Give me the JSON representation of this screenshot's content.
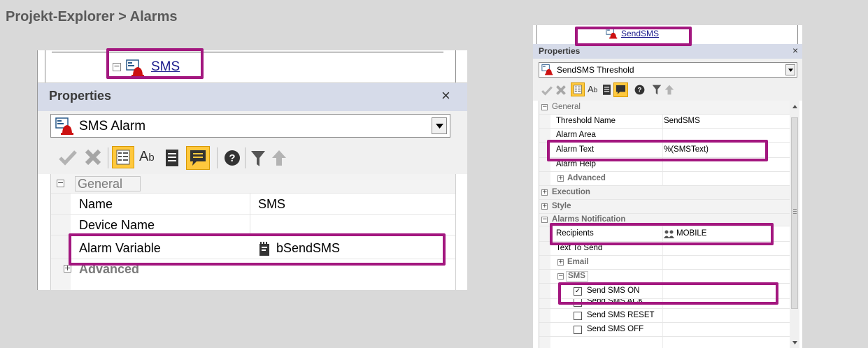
{
  "page_title": "Projekt-Explorer > Alarms",
  "left": {
    "tree_item_label": "SMS",
    "panel_title": "Properties",
    "selector_value": "SMS Alarm",
    "group_general": "General",
    "group_advanced": "Advanced",
    "properties": [
      {
        "name": "Name",
        "value": "SMS"
      },
      {
        "name": "Device Name",
        "value": ""
      },
      {
        "name": "Alarm Variable",
        "value": "bSendSMS"
      }
    ]
  },
  "right": {
    "tree_item_label": "SendSMS",
    "panel_title": "Properties",
    "selector_value": "SendSMS Threshold",
    "groups": {
      "general": "General",
      "advanced": "Advanced",
      "execution": "Execution",
      "style": "Style",
      "alarms_notification": "Alarms Notification",
      "email": "Email",
      "sms": "SMS"
    },
    "properties": {
      "threshold_name": {
        "name": "Threshold Name",
        "value": "SendSMS"
      },
      "alarm_area": {
        "name": "Alarm Area",
        "value": ""
      },
      "alarm_text": {
        "name": "Alarm Text",
        "value": "%(SMSText)"
      },
      "alarm_help": {
        "name": "Alarm Help",
        "value": ""
      },
      "recipients": {
        "name": "Recipients",
        "value": "MOBILE"
      },
      "text_to_send": {
        "name": "Text To Send",
        "value": ""
      }
    },
    "sms_options": [
      {
        "label": "Send SMS ON",
        "checked": true
      },
      {
        "label": "Send SMS ACK",
        "checked": false
      },
      {
        "label": "Send SMS RESET",
        "checked": false
      },
      {
        "label": "Send SMS OFF",
        "checked": false
      }
    ]
  },
  "colors": {
    "highlight": "#a3177f",
    "background": "#d9d9d9",
    "alarm_icon": "#cc1111"
  }
}
